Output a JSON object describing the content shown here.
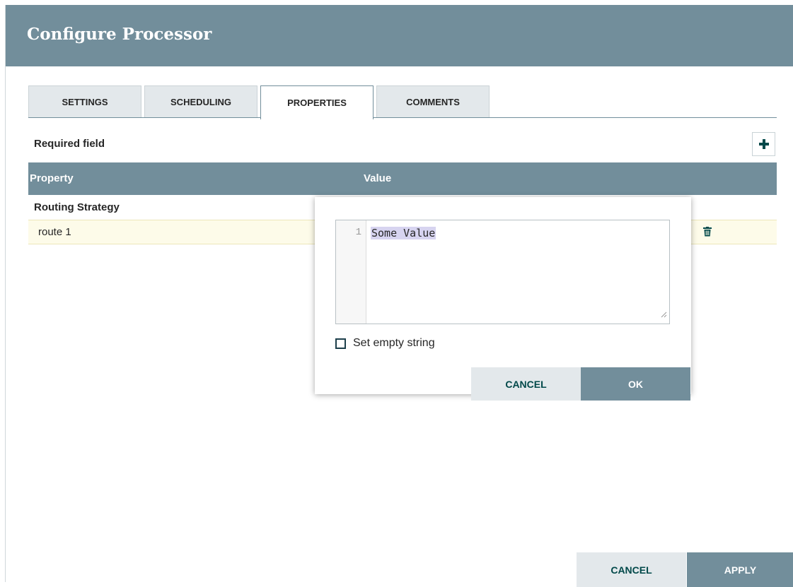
{
  "header": {
    "title": "Configure Processor"
  },
  "tabs": [
    {
      "label": "SETTINGS"
    },
    {
      "label": "SCHEDULING"
    },
    {
      "label": "PROPERTIES"
    },
    {
      "label": "COMMENTS"
    }
  ],
  "active_tab": "PROPERTIES",
  "required_label": "Required field",
  "table": {
    "columns": [
      "Property",
      "Value"
    ],
    "group_label": "Routing Strategy",
    "rows": [
      {
        "name": "route 1"
      }
    ]
  },
  "editor": {
    "line_number": "1",
    "value": "Some Value",
    "checkbox_label": "Set empty string",
    "checkbox_checked": false,
    "cancel_label": "CANCEL",
    "ok_label": "OK"
  },
  "footer": {
    "cancel_label": "CANCEL",
    "apply_label": "APPLY"
  },
  "colors": {
    "header": "#728e9b",
    "accent_text": "#004849",
    "row_highlight": "#fdfbe9"
  },
  "icons": {
    "add": "plus-icon",
    "delete": "trash-icon",
    "resize": "resize-handle-icon"
  }
}
